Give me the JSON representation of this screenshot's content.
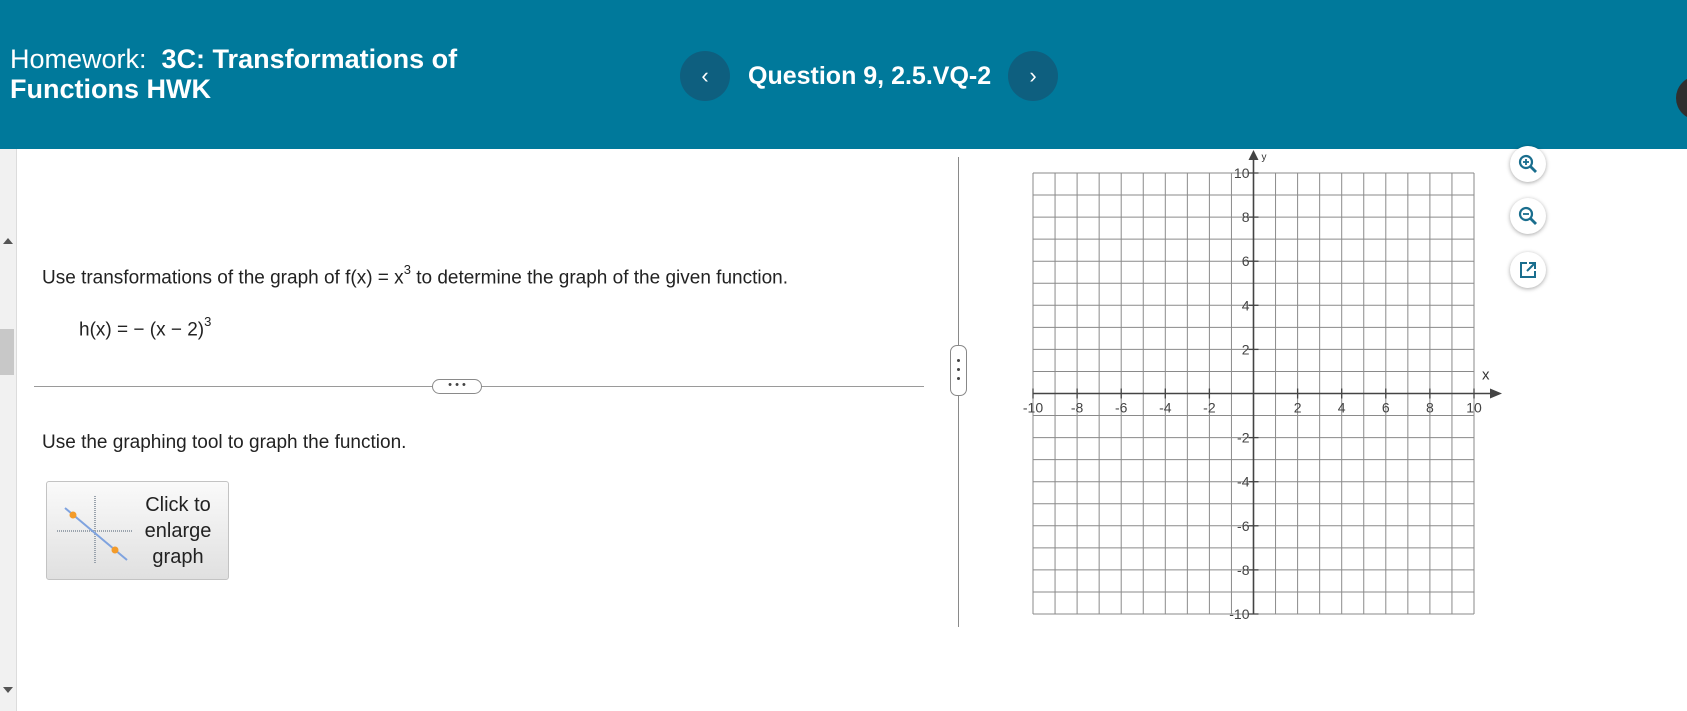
{
  "header": {
    "homework_label": "Homework:",
    "homework_name": "3C: Transformations of",
    "homework_name_cont": "Functions HWK",
    "question_title": "Question 9, 2.5.VQ-2",
    "prev_icon": "‹",
    "next_icon": "›"
  },
  "question": {
    "prompt_pre": "Use transformations of the graph of f(x) = x",
    "prompt_exp": "3",
    "prompt_post": " to determine the graph of the given function.",
    "function_base": "h(x) = − (x − 2)",
    "function_exp": "3",
    "more_label": "• • •",
    "instruction": "Use the graphing tool to graph the function."
  },
  "enlarge_button": {
    "label_1": "Click to",
    "label_2": "enlarge",
    "label_3": "graph"
  },
  "graph": {
    "x_axis_label": "x",
    "y_axis_label": "y",
    "x_ticks": [
      "-10",
      "-8",
      "-6",
      "-4",
      "-2",
      "2",
      "4",
      "6",
      "8",
      "10"
    ],
    "y_ticks": [
      "10",
      "8",
      "6",
      "4",
      "2",
      "-2",
      "-4",
      "-6",
      "-8",
      "-10"
    ],
    "x_range": [
      -10,
      10
    ],
    "y_range": [
      -10,
      10
    ],
    "grid": true
  },
  "tools": {
    "zoom_in": "zoom-in-icon",
    "zoom_out": "zoom-out-icon",
    "popout": "popout-icon"
  },
  "colors": {
    "header_bg": "#00799b",
    "nav_button_bg": "#0e5f7f",
    "grid_line": "#8a8a8a",
    "tool_icon": "#1a6e8e"
  }
}
